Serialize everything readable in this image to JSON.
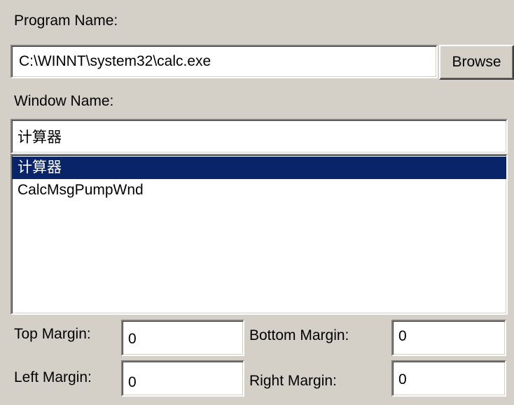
{
  "program": {
    "label": "Program Name:",
    "value": "C:\\WINNT\\system32\\calc.exe",
    "browse_label": "Browse"
  },
  "window": {
    "label": "Window Name:",
    "value": "计算器",
    "list": [
      {
        "label": "计算器",
        "selected": true
      },
      {
        "label": "CalcMsgPumpWnd",
        "selected": false
      }
    ]
  },
  "margins": {
    "top_label": "Top Margin:",
    "top_value": "0",
    "bottom_label": "Bottom Margin:",
    "bottom_value": "0",
    "left_label": "Left Margin:",
    "left_value": "0",
    "right_label": "Right Margin:",
    "right_value": "0"
  },
  "colors": {
    "dialog_bg": "#d4d0c8",
    "selection_bg": "#0a246a",
    "selection_fg": "#ffffff"
  }
}
